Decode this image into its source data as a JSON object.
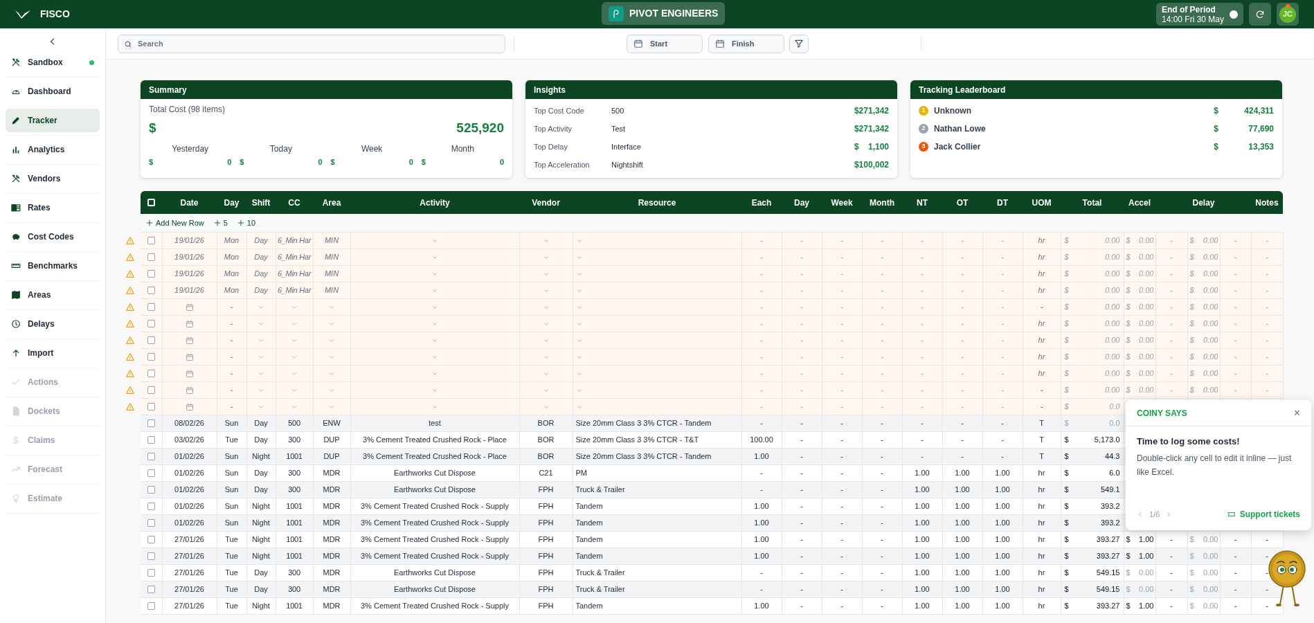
{
  "top_bar": {
    "app_name": "FISCO",
    "company": "PIVOT ENGINEERS",
    "period_label": "End of Period",
    "period_time": "14:00 Fri 30 May",
    "avatar_initials": "JC"
  },
  "sidebar": {
    "items": [
      {
        "label": "Sandbox",
        "selected": false,
        "disabled": false,
        "color": "#22c55e"
      },
      {
        "label": "Dashboard",
        "selected": false,
        "disabled": false
      },
      {
        "label": "Tracker",
        "selected": true,
        "disabled": false
      },
      {
        "label": "Analytics",
        "selected": false,
        "disabled": false
      },
      {
        "label": "Vendors",
        "selected": false,
        "disabled": false
      },
      {
        "label": "Rates",
        "selected": false,
        "disabled": false
      },
      {
        "label": "Cost Codes",
        "selected": false,
        "disabled": false
      },
      {
        "label": "Benchmarks",
        "selected": false,
        "disabled": false
      },
      {
        "label": "Areas",
        "selected": false,
        "disabled": false
      },
      {
        "label": "Delays",
        "selected": false,
        "disabled": false
      },
      {
        "label": "Import",
        "selected": false,
        "disabled": false
      },
      {
        "label": "Actions",
        "selected": false,
        "disabled": true
      },
      {
        "label": "Dockets",
        "selected": false,
        "disabled": true
      },
      {
        "label": "Claims",
        "selected": false,
        "disabled": true
      },
      {
        "label": "Forecast",
        "selected": false,
        "disabled": true
      },
      {
        "label": "Estimate",
        "selected": false,
        "disabled": true
      }
    ]
  },
  "toolbar": {
    "search": {
      "placeholder": "Search"
    },
    "start": "Start",
    "finish": "Finish"
  },
  "summary": {
    "title": "Summary",
    "subtitle": "Total Cost (98 items)",
    "currency": "$",
    "total": "525,920",
    "periods": [
      {
        "label": "Yesterday",
        "currency": "$",
        "value": "0"
      },
      {
        "label": "Today",
        "currency": "$",
        "value": "0"
      },
      {
        "label": "Week",
        "currency": "$",
        "value": "0"
      },
      {
        "label": "Month",
        "currency": "$",
        "value": "0"
      }
    ]
  },
  "insights": {
    "title": "Insights",
    "rows": [
      {
        "label": "Top Cost Code",
        "value": "500",
        "amount": "$271,342"
      },
      {
        "label": "Top Activity",
        "value": "Test",
        "amount": "$271,342"
      },
      {
        "label": "Top Delay",
        "value": "Interface",
        "amount": "$    1,100"
      },
      {
        "label": "Top Acceleration",
        "value": "Nightshift",
        "amount": "$100,002"
      }
    ]
  },
  "leaderboard": {
    "title": "Tracking Leaderboard",
    "rows": [
      {
        "rank": "1",
        "color": "#eab308",
        "name": "Unknown",
        "currency": "$",
        "amount": "424,311"
      },
      {
        "rank": "2",
        "color": "#9ca3af",
        "name": "Nathan Lowe",
        "currency": "$",
        "amount": "77,690"
      },
      {
        "rank": "3",
        "color": "#ea580c",
        "name": "Jack Collier",
        "currency": "$",
        "amount": "13,353"
      }
    ]
  },
  "table": {
    "all_checked": false,
    "columns": [
      "Date",
      "Day",
      "Shift",
      "CC",
      "Area",
      "Activity",
      "Vendor",
      "Resource",
      "Each",
      "Day",
      "Week",
      "Month",
      "NT",
      "OT",
      "DT",
      "UOM",
      "Total",
      "Accel",
      "",
      "Delay",
      "",
      "Notes"
    ],
    "add_buttons": [
      "Add New Row",
      "5",
      "10"
    ],
    "rows": [
      {
        "incomplete": true,
        "checked": false,
        "cells": [
          "19/01/26",
          "Mon",
          "Day",
          "6_Min Har",
          "MIN",
          null,
          null,
          null,
          "-",
          "-",
          "-",
          "-",
          "-",
          "-",
          "-",
          "hr",
          [
            "$",
            "0.00",
            true
          ],
          [
            "$",
            "0.00",
            true
          ],
          "-",
          [
            "$",
            "0.00",
            true
          ],
          "-",
          "-"
        ]
      },
      {
        "incomplete": true,
        "checked": false,
        "cells": [
          "19/01/26",
          "Mon",
          "Day",
          "6_Min Har",
          "MIN",
          null,
          null,
          null,
          "-",
          "-",
          "-",
          "-",
          "-",
          "-",
          "-",
          "hr",
          [
            "$",
            "0.00",
            true
          ],
          [
            "$",
            "0.00",
            true
          ],
          "-",
          [
            "$",
            "0.00",
            true
          ],
          "-",
          "-"
        ]
      },
      {
        "incomplete": true,
        "checked": false,
        "cells": [
          "19/01/26",
          "Mon",
          "Day",
          "6_Min Har",
          "MIN",
          null,
          null,
          null,
          "-",
          "-",
          "-",
          "-",
          "-",
          "-",
          "-",
          "hr",
          [
            "$",
            "0.00",
            true
          ],
          [
            "$",
            "0.00",
            true
          ],
          "-",
          [
            "$",
            "0.00",
            true
          ],
          "-",
          "-"
        ]
      },
      {
        "incomplete": true,
        "checked": false,
        "cells": [
          "19/01/26",
          "Mon",
          "Day",
          "6_Min Har",
          "MIN",
          null,
          null,
          null,
          "-",
          "-",
          "-",
          "-",
          "-",
          "-",
          "-",
          "hr",
          [
            "$",
            "0.00",
            true
          ],
          [
            "$",
            "0.00",
            true
          ],
          "-",
          [
            "$",
            "0.00",
            true
          ],
          "-",
          "-"
        ]
      },
      {
        "incomplete": true,
        "checked": false,
        "cells": [
          null,
          "-",
          null,
          null,
          null,
          null,
          null,
          null,
          "-",
          "-",
          "-",
          "-",
          "-",
          "-",
          "-",
          "-",
          [
            "$",
            "0.00",
            true
          ],
          [
            "$",
            "0.00",
            true
          ],
          "-",
          [
            "$",
            "0.00",
            true
          ],
          "-",
          "-"
        ]
      },
      {
        "incomplete": true,
        "checked": false,
        "cells": [
          null,
          "-",
          null,
          null,
          null,
          null,
          null,
          null,
          "-",
          "-",
          "-",
          "-",
          "-",
          "-",
          "-",
          "hr",
          [
            "$",
            "0.00",
            true
          ],
          [
            "$",
            "0.00",
            true
          ],
          "-",
          [
            "$",
            "0.00",
            true
          ],
          "-",
          "-"
        ]
      },
      {
        "incomplete": true,
        "checked": false,
        "cells": [
          null,
          "-",
          null,
          null,
          null,
          null,
          null,
          null,
          "-",
          "-",
          "-",
          "-",
          "-",
          "-",
          "-",
          "hr",
          [
            "$",
            "0.00",
            true
          ],
          [
            "$",
            "0.00",
            true
          ],
          "-",
          [
            "$",
            "0.00",
            true
          ],
          "-",
          "-"
        ]
      },
      {
        "incomplete": true,
        "checked": false,
        "cells": [
          null,
          "-",
          null,
          null,
          null,
          null,
          null,
          null,
          "-",
          "-",
          "-",
          "-",
          "-",
          "-",
          "-",
          "hr",
          [
            "$",
            "0.00",
            true
          ],
          [
            "$",
            "0.00",
            true
          ],
          "-",
          [
            "$",
            "0.00",
            true
          ],
          "-",
          "-"
        ]
      },
      {
        "incomplete": true,
        "checked": false,
        "cells": [
          null,
          "-",
          null,
          null,
          null,
          null,
          null,
          null,
          "-",
          "-",
          "-",
          "-",
          "-",
          "-",
          "-",
          "hr",
          [
            "$",
            "0.00",
            true
          ],
          [
            "$",
            "0.00",
            true
          ],
          "-",
          [
            "$",
            "0.00",
            true
          ],
          "-",
          "-"
        ]
      },
      {
        "incomplete": true,
        "checked": false,
        "cells": [
          null,
          "-",
          null,
          null,
          null,
          null,
          null,
          null,
          "-",
          "-",
          "-",
          "-",
          "-",
          "-",
          "-",
          "-",
          [
            "$",
            "0.00",
            true
          ],
          [
            "$",
            "0.00",
            true
          ],
          "-",
          [
            "$",
            "0.00",
            true
          ],
          "-",
          "-"
        ]
      },
      {
        "incomplete": true,
        "checked": false,
        "cells": [
          null,
          "-",
          null,
          null,
          null,
          null,
          null,
          null,
          "-",
          "-",
          "-",
          "-",
          "-",
          "-",
          "-",
          "-",
          [
            "$",
            "0.0",
            true
          ],
          null,
          null,
          null,
          null,
          null
        ]
      },
      {
        "incomplete": false,
        "checked": false,
        "cells": [
          "08/02/26",
          "Sun",
          "Day",
          "500",
          "ENW",
          "test",
          "BOR",
          "Size 20mm Class 3 3% CTCR - Tandem",
          "-",
          "-",
          "-",
          "-",
          "-",
          "-",
          "-",
          "T",
          [
            "$",
            "0.0",
            true
          ],
          null,
          null,
          null,
          null,
          null
        ]
      },
      {
        "incomplete": false,
        "checked": false,
        "cells": [
          "03/02/26",
          "Tue",
          "Day",
          "300",
          "DUP",
          "3% Cement Treated Crushed Rock - Place",
          "BOR",
          "Size 20mm Class 3 3% CTCR - T&T",
          "100.00",
          "-",
          "-",
          "-",
          "-",
          "-",
          "-",
          "T",
          [
            "$",
            "5,173.0",
            false
          ],
          null,
          null,
          null,
          null,
          null
        ]
      },
      {
        "incomplete": false,
        "checked": false,
        "cells": [
          "01/02/26",
          "Sun",
          "Night",
          "1001",
          "DUP",
          "3% Cement Treated Crushed Rock - Place",
          "BOR",
          "Size 20mm Class 3 3% CTCR - Tandem",
          "1.00",
          "-",
          "-",
          "-",
          "-",
          "-",
          "-",
          "T",
          [
            "$",
            "44.3",
            false
          ],
          null,
          null,
          null,
          null,
          null
        ]
      },
      {
        "incomplete": false,
        "checked": false,
        "cells": [
          "01/02/26",
          "Sun",
          "Day",
          "300",
          "MDR",
          "Earthworks Cut Dispose",
          "C21",
          "PM",
          "-",
          "-",
          "-",
          "-",
          "1.00",
          "1.00",
          "1.00",
          "hr",
          [
            "$",
            "6.0",
            false
          ],
          null,
          null,
          null,
          null,
          null
        ]
      },
      {
        "incomplete": false,
        "checked": false,
        "cells": [
          "01/02/26",
          "Sun",
          "Day",
          "300",
          "MDR",
          "Earthworks Cut Dispose",
          "FPH",
          "Truck & Trailer",
          "-",
          "-",
          "-",
          "-",
          "1.00",
          "1.00",
          "1.00",
          "hr",
          [
            "$",
            "549.1",
            false
          ],
          null,
          null,
          null,
          null,
          null
        ]
      },
      {
        "incomplete": false,
        "checked": false,
        "cells": [
          "01/02/26",
          "Sun",
          "Night",
          "1001",
          "MDR",
          "3% Cement Treated Crushed Rock - Supply",
          "FPH",
          "Tandem",
          "1.00",
          "-",
          "-",
          "-",
          "1.00",
          "1.00",
          "1.00",
          "hr",
          [
            "$",
            "393.2",
            false
          ],
          null,
          null,
          null,
          null,
          null
        ]
      },
      {
        "incomplete": false,
        "checked": false,
        "cells": [
          "01/02/26",
          "Sun",
          "Night",
          "1001",
          "MDR",
          "3% Cement Treated Crushed Rock - Supply",
          "FPH",
          "Tandem",
          "1.00",
          "-",
          "-",
          "-",
          "1.00",
          "1.00",
          "1.00",
          "hr",
          [
            "$",
            "393.2",
            false
          ],
          null,
          null,
          null,
          null,
          null
        ]
      },
      {
        "incomplete": false,
        "checked": false,
        "cells": [
          "27/01/26",
          "Tue",
          "Night",
          "1001",
          "MDR",
          "3% Cement Treated Crushed Rock - Supply",
          "FPH",
          "Tandem",
          "1.00",
          "-",
          "-",
          "-",
          "1.00",
          "1.00",
          "1.00",
          "hr",
          [
            "$",
            "393.27",
            false
          ],
          [
            "$",
            "1.00",
            false
          ],
          "-",
          [
            "$",
            "0.00",
            true
          ],
          "-",
          "-"
        ]
      },
      {
        "incomplete": false,
        "checked": false,
        "cells": [
          "27/01/26",
          "Tue",
          "Night",
          "1001",
          "MDR",
          "3% Cement Treated Crushed Rock - Supply",
          "FPH",
          "Tandem",
          "1.00",
          "-",
          "-",
          "-",
          "1.00",
          "1.00",
          "1.00",
          "hr",
          [
            "$",
            "393.27",
            false
          ],
          [
            "$",
            "1.00",
            false
          ],
          "-",
          [
            "$",
            "0.00",
            true
          ],
          "-",
          "-"
        ]
      },
      {
        "incomplete": false,
        "checked": false,
        "cells": [
          "27/01/26",
          "Tue",
          "Day",
          "300",
          "MDR",
          "Earthworks Cut Dispose",
          "FPH",
          "Truck & Trailer",
          "-",
          "-",
          "-",
          "-",
          "1.00",
          "1.00",
          "1.00",
          "hr",
          [
            "$",
            "549.15",
            false
          ],
          [
            "$",
            "0.00",
            true
          ],
          "-",
          [
            "$",
            "0.00",
            true
          ],
          "-",
          "-"
        ]
      },
      {
        "incomplete": false,
        "checked": false,
        "cells": [
          "27/01/26",
          "Tue",
          "Day",
          "300",
          "MDR",
          "Earthworks Cut Dispose",
          "FPH",
          "Truck & Trailer",
          "-",
          "-",
          "-",
          "-",
          "1.00",
          "1.00",
          "1.00",
          "hr",
          [
            "$",
            "549.15",
            false
          ],
          [
            "$",
            "0.00",
            true
          ],
          "-",
          [
            "$",
            "0.00",
            true
          ],
          "-",
          "-"
        ]
      },
      {
        "incomplete": false,
        "checked": false,
        "cells": [
          "27/01/26",
          "Tue",
          "Night",
          "1001",
          "MDR",
          "3% Cement Treated Crushed Rock - Supply",
          "FPH",
          "Tandem",
          "1.00",
          "-",
          "-",
          "-",
          "1.00",
          "1.00",
          "1.00",
          "hr",
          [
            "$",
            "393.27",
            false
          ],
          [
            "$",
            "1.00",
            false
          ],
          "-",
          [
            "$",
            "0.00",
            true
          ],
          "-",
          "-"
        ]
      }
    ]
  },
  "tip": {
    "heading": "COINY SAYS",
    "close": "×",
    "title": "Time to log some costs!",
    "body": "Double-click any cell to edit it inline — just like Excel.",
    "page": "1/6",
    "link": "Support tickets"
  }
}
